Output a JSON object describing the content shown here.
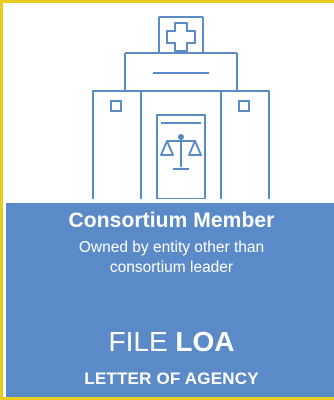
{
  "card": {
    "illustration_icon": "hospital-building-with-scales-of-justice",
    "title": "Consortium Member",
    "subtitle_line1": "Owned by entity other than",
    "subtitle_line2": "consortium leader",
    "action_word": "FILE",
    "action_emphasis": "LOA",
    "action_full": "LETTER OF AGENCY"
  },
  "colors": {
    "border": "#e8cc1e",
    "banner": "#5b8ac9",
    "icon_stroke": "#5b8ac9",
    "text": "#ffffff"
  }
}
